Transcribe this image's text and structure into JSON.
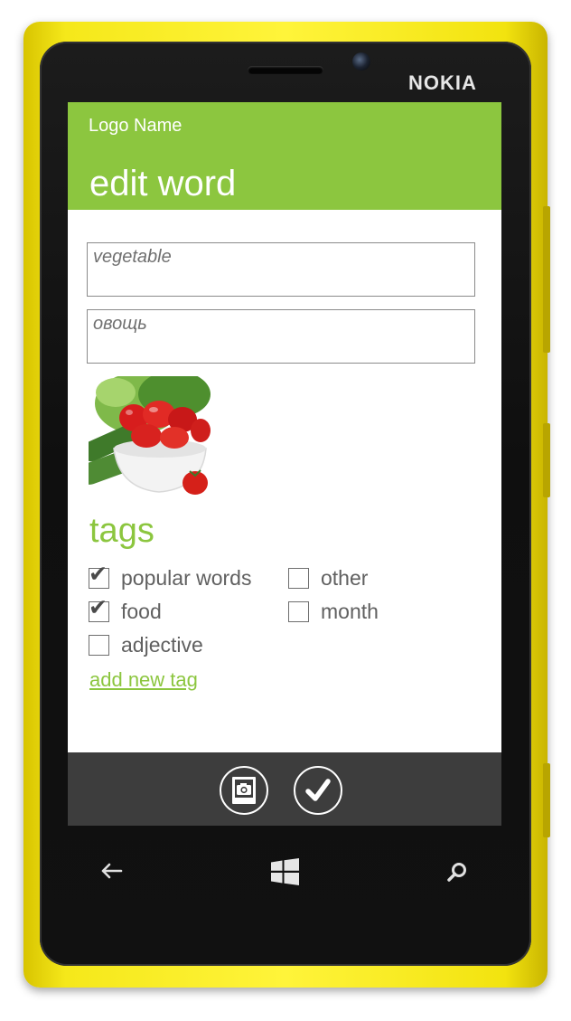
{
  "device": {
    "brand": "NOKIA"
  },
  "header": {
    "logo_name": "Logo Name",
    "title": "edit word"
  },
  "form": {
    "word_field": {
      "placeholder": "vegetable"
    },
    "translation_field": {
      "placeholder": "овощь"
    },
    "image": {
      "icon": "vegetables-photo"
    }
  },
  "tags": {
    "heading": "tags",
    "items": [
      {
        "label": "popular words",
        "checked": true
      },
      {
        "label": "food",
        "checked": true
      },
      {
        "label": "adjective",
        "checked": false
      },
      {
        "label": "other",
        "checked": false
      },
      {
        "label": "month",
        "checked": false
      }
    ],
    "add_link": "add new tag "
  },
  "app_bar": {
    "buttons": [
      {
        "icon": "camera-icon"
      },
      {
        "icon": "checkmark-icon"
      }
    ]
  },
  "hardware_keys": [
    {
      "icon": "back-arrow-icon"
    },
    {
      "icon": "windows-start-icon"
    },
    {
      "icon": "search-icon"
    }
  ],
  "colors": {
    "accent": "#8cc63f",
    "app_bar": "#3d3d3d",
    "frame": "#f5e81a"
  }
}
